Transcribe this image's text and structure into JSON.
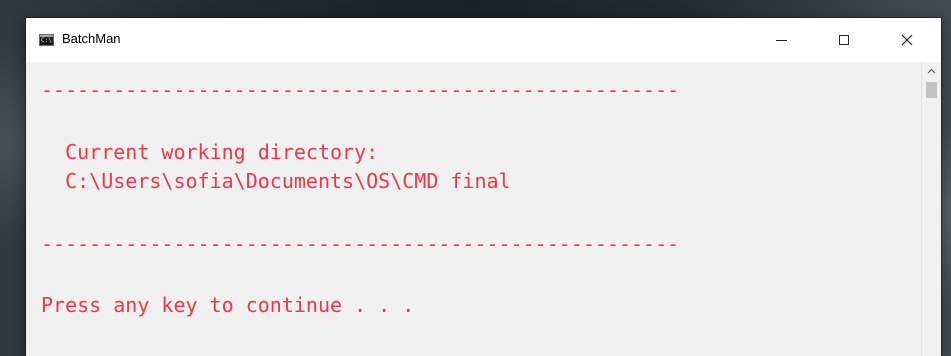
{
  "window": {
    "title": "BatchMan",
    "icon": "cmd-console-icon",
    "icon_glyph": "C:\\"
  },
  "console": {
    "lines": [
      "-----------------------------------------------------",
      "  Current working directory:",
      "  C:\\Users\\sofia\\Documents\\OS\\CMD final",
      "-----------------------------------------------------",
      "Press any key to continue . . ."
    ],
    "text_color": "#e8394a",
    "background_color": "#f0f0f0"
  },
  "controls": {
    "minimize": "minimize-icon",
    "maximize": "maximize-icon",
    "close": "close-icon"
  }
}
